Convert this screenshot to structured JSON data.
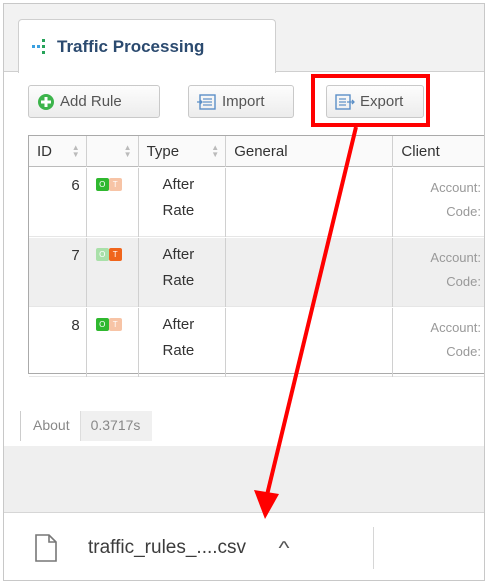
{
  "tab": {
    "title": "Traffic Processing"
  },
  "toolbar": {
    "add_rule_label": "Add Rule",
    "import_label": "Import",
    "export_label": "Export"
  },
  "grid": {
    "columns": [
      "ID",
      "",
      "Type",
      "General",
      "Client"
    ],
    "rows": [
      {
        "id": "6",
        "status_left": "O",
        "status_right": "T",
        "type_line1": "After",
        "type_line2": "Rate",
        "client_label1": "Account:",
        "client_label2": "Code:"
      },
      {
        "id": "7",
        "status_left": "O",
        "status_right": "T",
        "type_line1": "After",
        "type_line2": "Rate",
        "client_label1": "Account:",
        "client_label2": "Code:"
      },
      {
        "id": "8",
        "status_left": "O",
        "status_right": "T",
        "type_line1": "After",
        "type_line2": "Rate",
        "client_label1": "Account:",
        "client_label2": "Code:"
      }
    ]
  },
  "footer": {
    "about_label": "About",
    "timing_value": "0.3717s"
  },
  "download": {
    "file_name": "traffic_rules_....csv",
    "menu_caret": "^"
  },
  "colors": {
    "highlight": "#ff0000",
    "arrow": "#ff0000",
    "status_green": "#2fb82f",
    "status_orange": "#f0651b",
    "tab_title": "#2b4a6f"
  },
  "icons": {
    "tab": "grid-dots-icon",
    "add": "plus-circle-icon",
    "import": "import-icon",
    "export": "export-icon",
    "file": "document-icon",
    "caret": "chevron-up-icon"
  }
}
